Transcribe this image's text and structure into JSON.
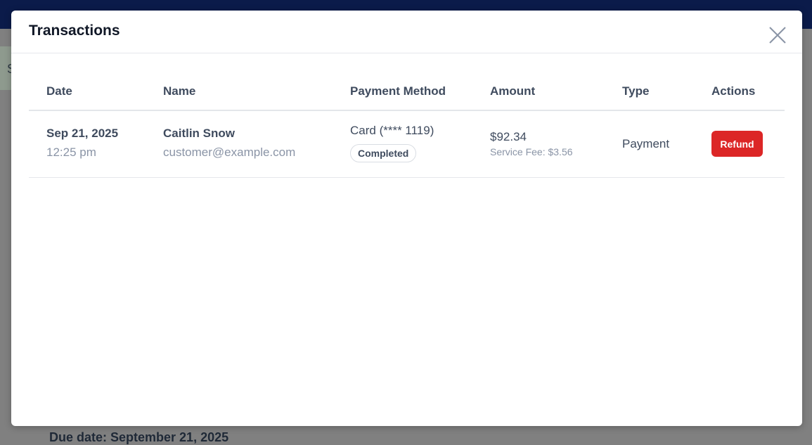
{
  "modal": {
    "title": "Transactions"
  },
  "table": {
    "headers": [
      "Date",
      "Name",
      "Payment Method",
      "Amount",
      "Type",
      "Actions"
    ],
    "rows": [
      {
        "date": "Sep 21, 2025",
        "time": "12:25 pm",
        "name": "Caitlin Snow",
        "email": "customer@example.com",
        "payment_method": "Card (**** 1119)",
        "status": "Completed",
        "amount": "$92.34",
        "service_fee": "Service Fee: $3.56",
        "type": "Payment",
        "action_label": "Refund"
      }
    ]
  },
  "background": {
    "sidebar_letter": "S",
    "footer_text": "Due date: September 21, 2025"
  },
  "colors": {
    "topbar": "#0b1b4a",
    "refund_button": "#dc2626"
  }
}
